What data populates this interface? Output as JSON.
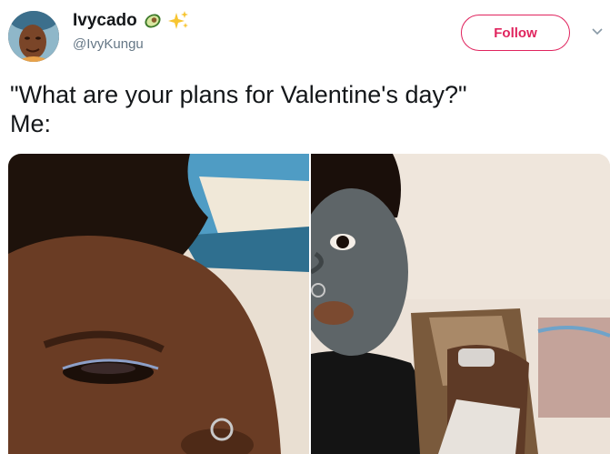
{
  "user": {
    "display_name": "Ivycado",
    "handle": "@IvyKungu",
    "name_emojis": [
      "avocado-icon",
      "sparkles-icon"
    ]
  },
  "actions": {
    "follow_label": "Follow",
    "menu_icon": "chevron-down-icon"
  },
  "tweet": {
    "text": "\"What are your plans for Valentine's day?\"\nMe:"
  },
  "media": {
    "photos": [
      "selfie-eye-closeup",
      "selfie-face-mask-eating"
    ]
  },
  "colors": {
    "accent": "#e0245e",
    "text": "#14171a",
    "secondary_text": "#657786"
  }
}
